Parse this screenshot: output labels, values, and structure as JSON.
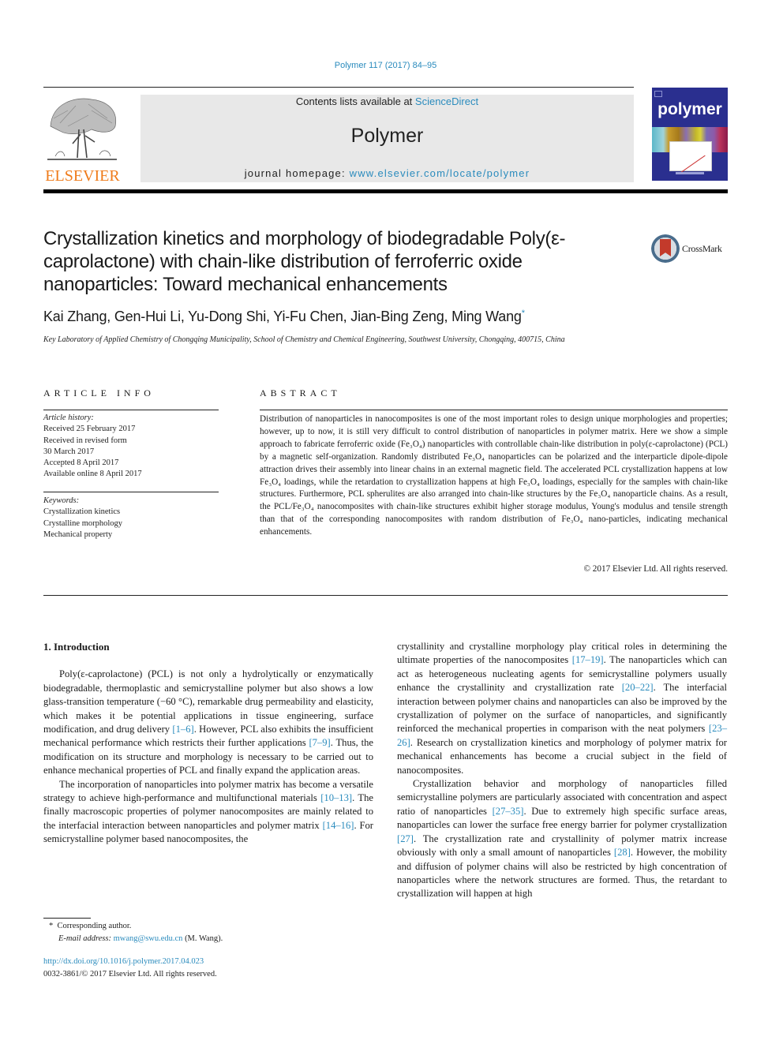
{
  "header": {
    "citation": "Polymer 117 (2017) 84–95",
    "contents_prefix": "Contents lists available at ",
    "contents_link": "ScienceDirect",
    "journal_name": "Polymer",
    "homepage_prefix": "journal homepage: ",
    "homepage_link": "www.elsevier.com/locate/polymer",
    "publisher_logo_text": "ELSEVIER",
    "cover_title": "polymer",
    "colors": {
      "link": "#2a8bbd",
      "elsevier_orange": "#ef7b1a",
      "cover_blue": "#2a2f8f"
    }
  },
  "article": {
    "title": "Crystallization kinetics and morphology of biodegradable Poly(ε-caprolactone) with chain-like distribution of ferroferric oxide nanoparticles: Toward mechanical enhancements",
    "crossmark_label": "CrossMark",
    "authors": "Kai Zhang, Gen-Hui Li, Yu-Dong Shi, Yi-Fu Chen, Jian-Bing Zeng, Ming Wang",
    "corresponding_mark": "*",
    "affiliation": "Key Laboratory of Applied Chemistry of Chongqing Municipality, School of Chemistry and Chemical Engineering, Southwest University, Chongqing, 400715, China"
  },
  "article_info": {
    "heading": "ARTICLE INFO",
    "history_label": "Article history:",
    "history": [
      "Received 25 February 2017",
      "Received in revised form",
      "30 March 2017",
      "Accepted 8 April 2017",
      "Available online 8 April 2017"
    ],
    "keywords_label": "Keywords:",
    "keywords": [
      "Crystallization kinetics",
      "Crystalline morphology",
      "Mechanical property"
    ]
  },
  "abstract": {
    "heading": "ABSTRACT",
    "body": "Distribution of nanoparticles in nanocomposites is one of the most important roles to design unique morphologies and properties; however, up to now, it is still very difficult to control distribution of nanoparticles in polymer matrix. Here we show a simple approach to fabricate ferroferric oxide (Fe₃O₄) nanoparticles with controllable chain-like distribution in poly(ε-caprolactone) (PCL) by a magnetic self-organization. Randomly distributed Fe₃O₄ nanoparticles can be polarized and the interparticle dipole-dipole attraction drives their assembly into linear chains in an external magnetic field. The accelerated PCL crystallization happens at low Fe₃O₄ loadings, while the retardation to crystallization happens at high Fe₃O₄ loadings, especially for the samples with chain-like structures. Furthermore, PCL spherulites are also arranged into chain-like structures by the Fe₃O₄ nanoparticle chains. As a result, the PCL/Fe₃O₄ nanocomposites with chain-like structures exhibit higher storage modulus, Young's modulus and tensile strength than that of the corresponding nanocomposites with random distribution of Fe₃O₄ nano-particles, indicating mechanical enhancements.",
    "copyright": "© 2017 Elsevier Ltd. All rights reserved."
  },
  "body": {
    "section_heading": "1.  Introduction",
    "left_paragraphs": [
      [
        {
          "t": "Poly(ε-caprolactone) (PCL) is not only a hydrolytically or enzymatically biodegradable, thermoplastic and semicrystalline polymer but also shows a low glass-transition temperature (−60 °C), remarkable drug permeability and elasticity, which makes it be potential applications in tissue engineering, surface modification, and drug delivery "
        },
        {
          "ref": "[1–6]"
        },
        {
          "t": ". However, PCL also exhibits the insufficient mechanical performance which restricts their further applications "
        },
        {
          "ref": "[7–9]"
        },
        {
          "t": ". Thus, the modification on its structure and morphology is necessary to be carried out to enhance mechanical properties of PCL and finally expand the application areas."
        }
      ],
      [
        {
          "t": "The incorporation of nanoparticles into polymer matrix has become a versatile strategy to achieve high-performance and multifunctional materials "
        },
        {
          "ref": "[10–13]"
        },
        {
          "t": ". The finally macroscopic properties of polymer nanocomposites are mainly related to the interfacial interaction between nanoparticles and polymer matrix "
        },
        {
          "ref": "[14–16]"
        },
        {
          "t": ". For semicrystalline polymer based nanocomposites, the"
        }
      ]
    ],
    "right_paragraphs": [
      [
        {
          "t": "crystallinity and crystalline morphology play critical roles in determining the ultimate properties of the nanocomposites "
        },
        {
          "ref": "[17–19]"
        },
        {
          "t": ". The nanoparticles which can act as heterogeneous nucleating agents for semicrystalline polymers usually enhance the crystallinity and crystallization rate "
        },
        {
          "ref": "[20–22]"
        },
        {
          "t": ". The interfacial interaction between polymer chains and nanoparticles can also be improved by the crystallization of polymer on the surface of nanoparticles, and significantly reinforced the mechanical properties in comparison with the neat polymers "
        },
        {
          "ref": "[23–26]"
        },
        {
          "t": ". Research on crystallization kinetics and morphology of polymer matrix for mechanical enhancements has become a crucial subject in the field of nanocomposites."
        }
      ],
      [
        {
          "t": "Crystallization behavior and morphology of nanoparticles filled semicrystalline polymers are particularly associated with concentration and aspect ratio of nanoparticles "
        },
        {
          "ref": "[27–35]"
        },
        {
          "t": ". Due to extremely high specific surface areas, nanoparticles can lower the surface free energy barrier for polymer crystallization "
        },
        {
          "ref": "[27]"
        },
        {
          "t": ". The crystallization rate and crystallinity of polymer matrix increase obviously with only a small amount of nanoparticles "
        },
        {
          "ref": "[28]"
        },
        {
          "t": ". However, the mobility and diffusion of polymer chains will also be restricted by high concentration of nanoparticles where the network structures are formed. Thus, the retardant to crystallization will happen at high"
        }
      ]
    ]
  },
  "footnote": {
    "mark": "*",
    "corresponding": "Corresponding author.",
    "email_label": "E-mail address:",
    "email": "mwang@swu.edu.cn",
    "email_suffix": " (M. Wang)."
  },
  "doi": {
    "link": "http://dx.doi.org/10.1016/j.polymer.2017.04.023",
    "issn_line": "0032-3861/© 2017 Elsevier Ltd. All rights reserved."
  }
}
